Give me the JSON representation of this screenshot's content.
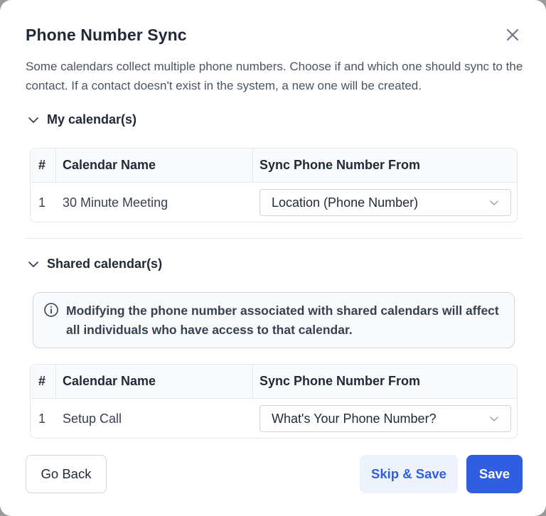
{
  "modal": {
    "title": "Phone Number Sync",
    "description": "Some calendars collect multiple phone numbers. Choose if and which one should sync to the contact. If a contact doesn't exist in the system, a new one will be created."
  },
  "my_calendars": {
    "heading": "My calendar(s)",
    "columns": [
      "#",
      "Calendar Name",
      "Sync Phone Number From"
    ],
    "rows": [
      {
        "num": "1",
        "name": "30 Minute Meeting",
        "sync_from": "Location (Phone Number)"
      }
    ]
  },
  "shared_calendars": {
    "heading": "Shared calendar(s)",
    "alert": "Modifying the phone number associated with shared calendars will affect all individuals who have access to that calendar.",
    "columns": [
      "#",
      "Calendar Name",
      "Sync Phone Number From"
    ],
    "rows": [
      {
        "num": "1",
        "name": "Setup Call",
        "sync_from": "What's Your Phone Number?"
      }
    ]
  },
  "footer": {
    "back_label": "Go Back",
    "skip_label": "Skip & Save",
    "save_label": "Save"
  },
  "colors": {
    "primary": "#2f5fe0",
    "primary_light": "#eef2fd",
    "border": "#e5e7eb",
    "text": "#1f2937"
  },
  "icons": {
    "close": "close-icon",
    "section_toggle": "chevron-down-icon",
    "select_arrow": "chevron-down-icon",
    "alert": "info-icon"
  }
}
